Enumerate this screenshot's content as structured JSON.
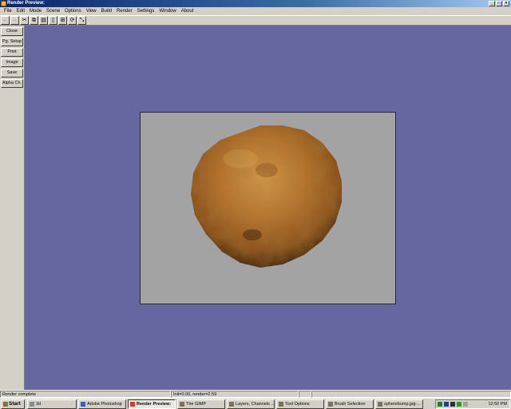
{
  "window": {
    "title": "Render Preview:"
  },
  "menubar": {
    "items": [
      "File",
      "Edit",
      "Mode",
      "Scene",
      "Options",
      "View",
      "Build",
      "Render",
      "Settings",
      "Window",
      "About"
    ]
  },
  "sidebar": {
    "buttons": [
      "Close",
      "Pg. Setup",
      "Print",
      "Image",
      "Save",
      "Alpha Ch."
    ]
  },
  "statusbar": {
    "status": "Render complete",
    "timing": "Init=0.00, render=2.59"
  },
  "taskbar": {
    "start_label": "Start",
    "tasks": [
      "3d",
      "Adobe Photoshop",
      "Render Preview:",
      "The GIMP",
      "Layers, Channels ...",
      "Tool Options",
      "Brush Selection",
      "spherebump.jpg-..."
    ],
    "active_task": "Render Preview:",
    "clock": "12:50 PM"
  },
  "colors": {
    "workspace": "#6666a0",
    "canvas": "#a3a3a3",
    "title_gradient_start": "#0a246a",
    "title_gradient_end": "#a6caf0",
    "sphere_base": "#b06a20"
  }
}
